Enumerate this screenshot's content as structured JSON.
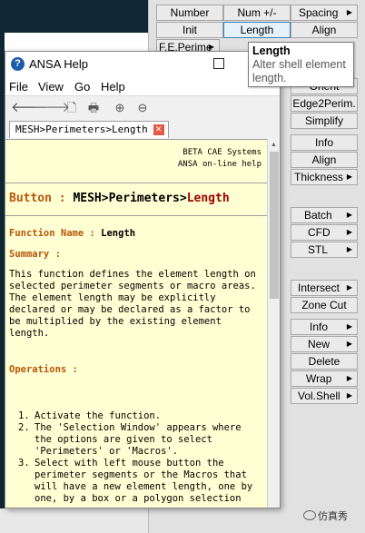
{
  "panel": {
    "buttons": [
      {
        "label": "Number"
      },
      {
        "label": "Num +/-"
      },
      {
        "label": "Spacing"
      },
      {
        "label": "Init"
      },
      {
        "label": "Length"
      },
      {
        "label": "Align"
      },
      {
        "label": "F.E.Perime"
      },
      {
        "label": "Orient"
      },
      {
        "label": "Edge2Perim."
      },
      {
        "label": "Simplify"
      },
      {
        "label": "Info"
      },
      {
        "label": "Align"
      },
      {
        "label": "Thickness"
      },
      {
        "label": "Batch"
      },
      {
        "label": "CFD"
      },
      {
        "label": "STL"
      },
      {
        "label": "Intersect"
      },
      {
        "label": "Zone Cut"
      },
      {
        "label": "Info"
      },
      {
        "label": "New"
      },
      {
        "label": "Delete"
      },
      {
        "label": "Wrap"
      },
      {
        "label": "Vol.Shell"
      }
    ],
    "selected": "Length"
  },
  "tooltip": {
    "title": "Length",
    "text": "Alter shell element length."
  },
  "help_window": {
    "title": "ANSA Help",
    "icon": "question-circle-icon",
    "menu": [
      "File",
      "View",
      "Go",
      "Help"
    ],
    "toolbar_icons": [
      "back-arrow-icon",
      "forward-arrow-icon",
      "page-icon",
      "print-icon",
      "zoom-in-icon",
      "zoom-out-icon"
    ],
    "tab_label": "MESH>Perimeters>Length",
    "content": {
      "company_line1": "BETA CAE Systems",
      "company_line2": "ANSA on-line help",
      "button_label": "Button :",
      "button_path": "MESH>Perimeters>",
      "button_name": "Length",
      "function_label": "Function Name :",
      "function_name": "Length",
      "summary_label": "Summary :",
      "summary_text": "This function defines the element length on selected perimeter segments or macro areas. The element length may be explicitly declared or may be declared as a factor to be multiplied by the existing element length.",
      "operations_label": "Operations :",
      "steps": [
        {
          "num": "1.",
          "text": "Activate the function."
        },
        {
          "num": "2.",
          "text": "The 'Selection Window' appears where the options are given to select 'Perimeters' or 'Macros'."
        },
        {
          "num": "3.",
          "text": "Select with left mouse button the perimeter segments or the Macros that will have a new element length, one by one, by a box or a polygon selection"
        }
      ]
    }
  },
  "watermark": "仿真秀"
}
